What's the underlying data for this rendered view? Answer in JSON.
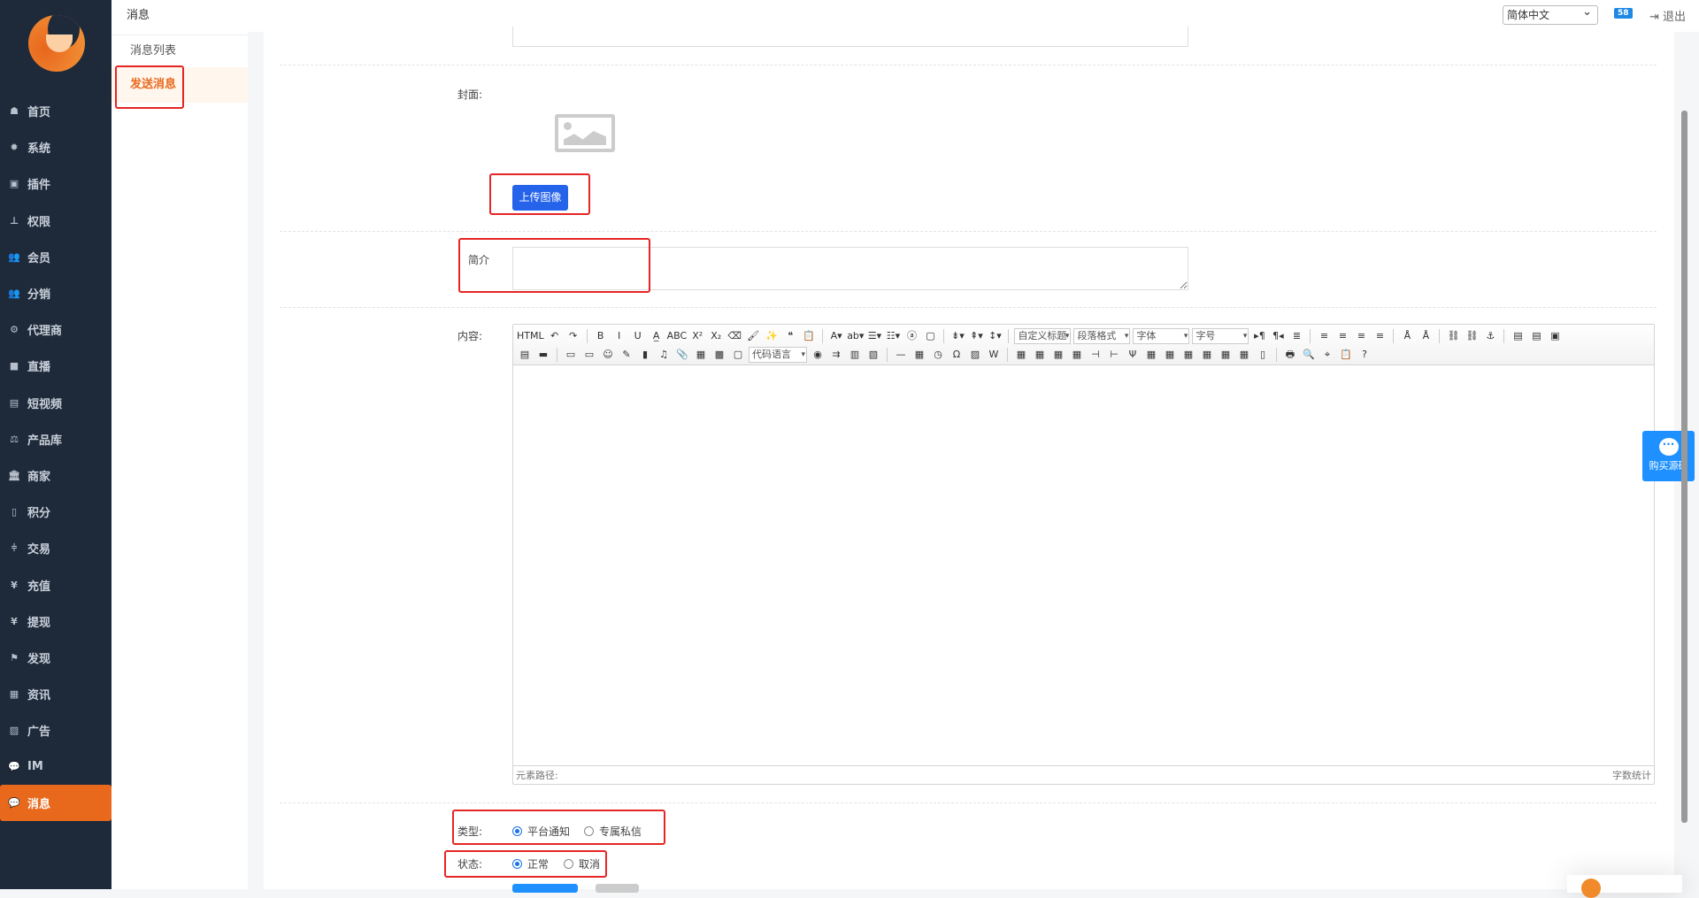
{
  "sidebar": {
    "items": [
      {
        "label": "首页",
        "icon": "☗",
        "name": "home"
      },
      {
        "label": "系统",
        "icon": "✹",
        "name": "gear"
      },
      {
        "label": "插件",
        "icon": "▣",
        "name": "plugin"
      },
      {
        "label": "权限",
        "icon": "⊥",
        "name": "sitemap"
      },
      {
        "label": "会员",
        "icon": "👥",
        "name": "users"
      },
      {
        "label": "分销",
        "icon": "👥",
        "name": "users"
      },
      {
        "label": "代理商",
        "icon": "⚙",
        "name": "cubes"
      },
      {
        "label": "直播",
        "icon": "■",
        "name": "video"
      },
      {
        "label": "短视频",
        "icon": "▤",
        "name": "file-video"
      },
      {
        "label": "产品库",
        "icon": "⚖",
        "name": "balance"
      },
      {
        "label": "商家",
        "icon": "🏛",
        "name": "bank"
      },
      {
        "label": "积分",
        "icon": "▯",
        "name": "file-points"
      },
      {
        "label": "交易",
        "icon": "⫩",
        "name": "exchange"
      },
      {
        "label": "充值",
        "icon": "¥",
        "name": "yen"
      },
      {
        "label": "提现",
        "icon": "¥",
        "name": "yen"
      },
      {
        "label": "发现",
        "icon": "⚑",
        "name": "flag"
      },
      {
        "label": "资讯",
        "icon": "▦",
        "name": "newspaper"
      },
      {
        "label": "广告",
        "icon": "▨",
        "name": "picture"
      },
      {
        "label": "IM",
        "icon": "💬",
        "name": "comments"
      },
      {
        "label": "消息",
        "icon": "💬",
        "name": "comment",
        "active": true
      }
    ]
  },
  "submenu": {
    "title": "消息",
    "items": [
      {
        "label": "消息列表"
      },
      {
        "label": "发送消息",
        "active": true
      }
    ]
  },
  "topbar": {
    "language": "简体中文",
    "badge": "58",
    "logout": "退出"
  },
  "form": {
    "cover_label": "封面:",
    "upload_button": "上传图像",
    "summary_label": "简介",
    "summary_value": "",
    "content_label": "内容:",
    "editor": {
      "row1": [
        "HTML",
        "↶",
        "↷",
        "|",
        "B",
        "I",
        "U",
        "A̲",
        "ABC",
        "X²",
        "X₂",
        "⌫",
        "🖌",
        "✨",
        "❝",
        "📋",
        "|",
        "A▾",
        "ab▾",
        "☰▾",
        "☷▾",
        "ⓐ",
        "▢",
        "|",
        "⇟▾",
        "⇞▾",
        "↕▾",
        "|"
      ],
      "selects": [
        "自定义标题",
        "段落格式",
        "字体",
        "字号"
      ],
      "row1b": [
        "▸¶",
        "¶◂",
        "≣",
        "|",
        "≡",
        "≡",
        "≡",
        "≡",
        "|",
        "Å",
        "Å",
        "|",
        "⛓",
        "⛓",
        "⚓",
        "|",
        "▤",
        "▤",
        "▣"
      ],
      "row2": [
        "▤",
        "▬",
        "|",
        "▭",
        "▭",
        "☺",
        "✎",
        "▮",
        "♫",
        "📎",
        "▦",
        "▩",
        "▢"
      ],
      "code_select": "代码语言",
      "row2b": [
        "◉",
        "⇉",
        "▥",
        "▧",
        "|",
        "—",
        "▦",
        "◷",
        "Ω",
        "▨",
        "W",
        "|",
        "▦",
        "▦",
        "▦",
        "▦",
        "⊣",
        "⊢",
        "Ψ",
        "▦",
        "▦",
        "▦",
        "▦",
        "▦",
        "▦",
        "▯",
        "|",
        "🖶",
        "🔍",
        "⌖",
        "📋",
        "?"
      ],
      "path_label": "元素路径:",
      "count_label": "字数统计"
    },
    "type_label": "类型:",
    "type_options": [
      {
        "label": "平台通知",
        "checked": true
      },
      {
        "label": "专属私信",
        "checked": false
      }
    ],
    "status_label": "状态:",
    "status_options": [
      {
        "label": "正常",
        "checked": true
      },
      {
        "label": "取消",
        "checked": false
      }
    ]
  },
  "float_button": {
    "label": "购买源码"
  },
  "colors": {
    "sidebar": "#1e2a3a",
    "accent": "#e8691c",
    "primary": "#2563eb",
    "highlight": "#e62525"
  }
}
